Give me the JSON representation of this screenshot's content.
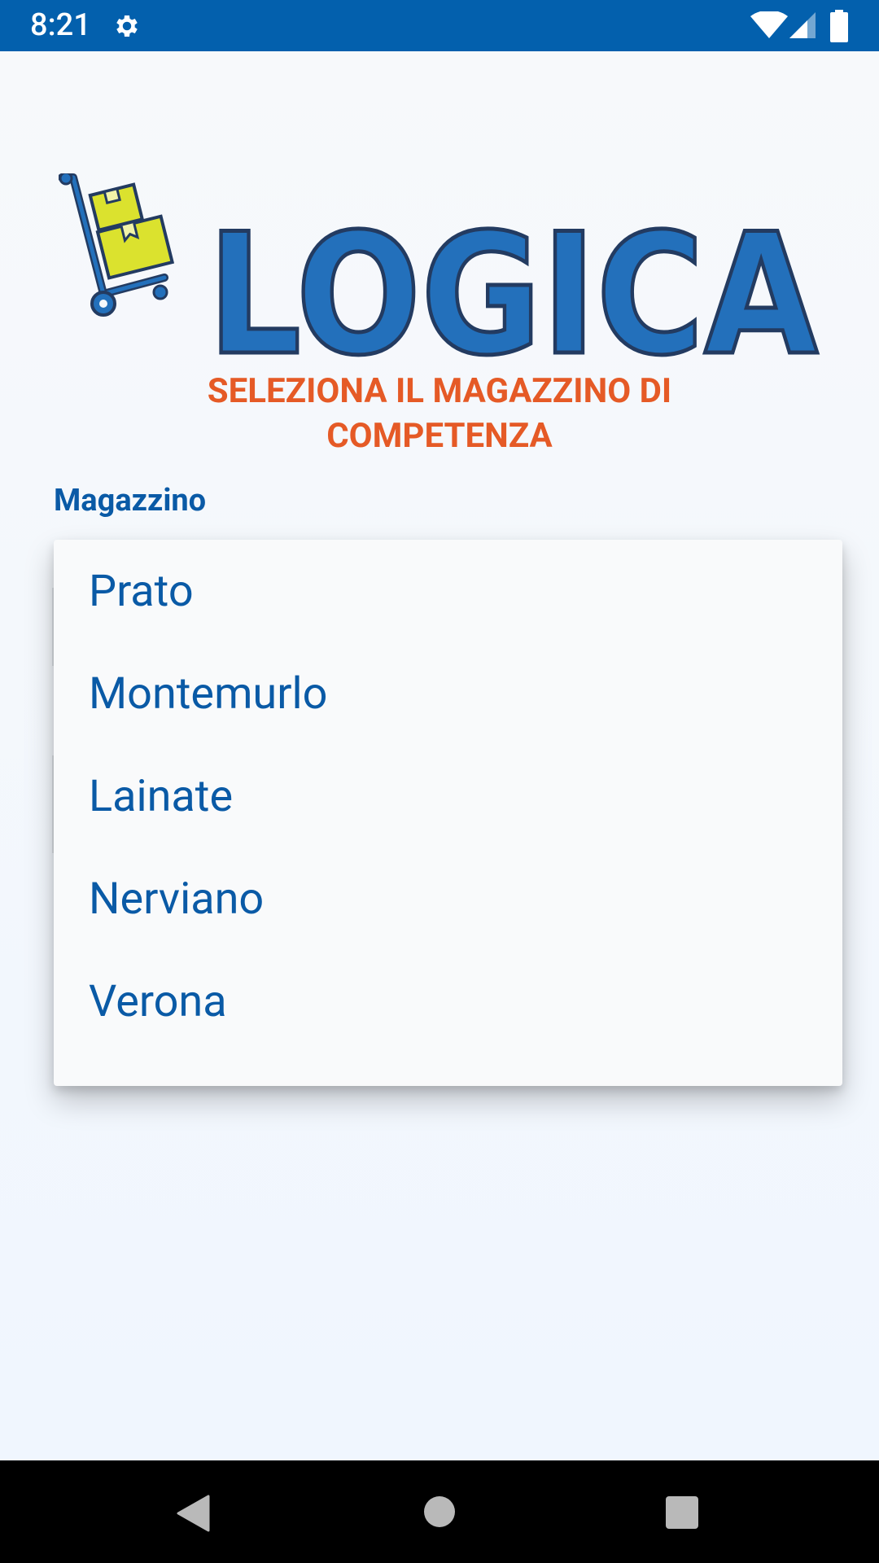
{
  "status_bar": {
    "time": "8:21",
    "icons": [
      "gear-icon",
      "wifi-icon",
      "signal-icon",
      "battery-icon"
    ],
    "background": "#0360ad"
  },
  "logo": {
    "text": "LOGICA",
    "icon": "hand-truck-boxes-icon"
  },
  "heading": {
    "line1": "SELEZIONA IL MAGAZZINO DI",
    "line2": "COMPETENZA"
  },
  "field": {
    "label": "Magazzino"
  },
  "dropdown": {
    "options": [
      "Prato",
      "Montemurlo",
      "Lainate",
      "Nerviano",
      "Verona"
    ]
  },
  "nav_bar": {
    "icons": [
      "back-icon",
      "home-icon",
      "recents-icon"
    ]
  },
  "colors": {
    "accent": "#e55a26",
    "primary": "#0a5aa6",
    "logo_blue": "#2370bb",
    "logo_outline": "#233b61",
    "box_yellow": "#dbe22e"
  }
}
